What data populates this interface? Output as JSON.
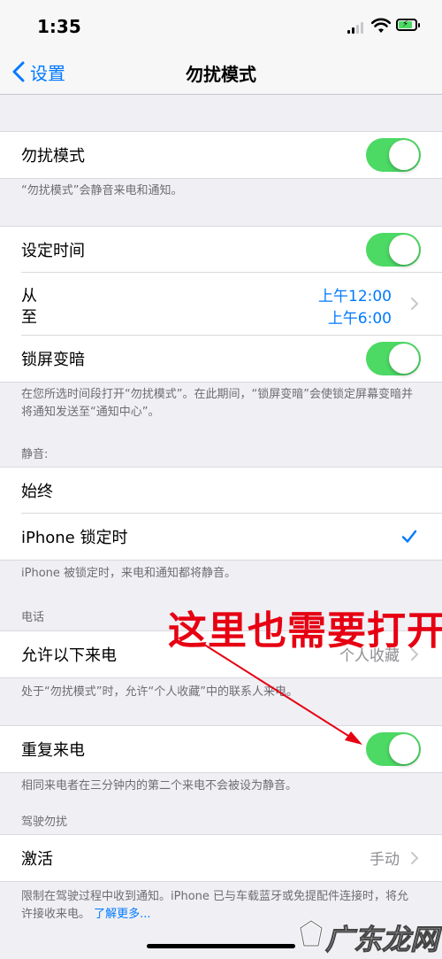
{
  "status": {
    "time": "1:35"
  },
  "nav": {
    "back_label": "设置",
    "title": "勿扰模式"
  },
  "dnd": {
    "label": "勿扰模式",
    "footer": "“勿扰模式”会静音来电和通知。"
  },
  "schedule": {
    "label": "设定时间",
    "from_label": "从",
    "to_label": "至",
    "from_time": "上午12:00",
    "to_time": "上午6:00",
    "dim_label": "锁屏变暗",
    "footer": "在您所选时间段打开“勿扰模式”。在此期间，“锁屏变暗”会使锁定屏幕变暗并将通知发送至“通知中心”。"
  },
  "silence": {
    "header": "静音:",
    "always": "始终",
    "locked": "iPhone 锁定时",
    "footer": "iPhone 被锁定时，来电和通知都将静音。"
  },
  "phone": {
    "header": "电话",
    "allow_label": "允许以下来电",
    "allow_value": "个人收藏",
    "allow_footer": "处于“勿扰模式”时，允许“个人收藏”中的联系人来电。",
    "repeat_label": "重复来电",
    "repeat_footer": "相同来电者在三分钟内的第二个来电不会被设为静音。"
  },
  "driving": {
    "header": "驾驶勿扰",
    "activate_label": "激活",
    "activate_value": "手动",
    "footer": "限制在驾驶过程中收到通知。iPhone 已与车载蓝牙或免提配件连接时，将允许接收来电。",
    "learn_more": "了解更多..."
  },
  "annotation": {
    "text": "这里也需要打开"
  },
  "watermark": {
    "text": "广东龙网"
  },
  "colors": {
    "accent": "#007aff",
    "toggle_on": "#4cd964",
    "annotation": "#e60012"
  }
}
